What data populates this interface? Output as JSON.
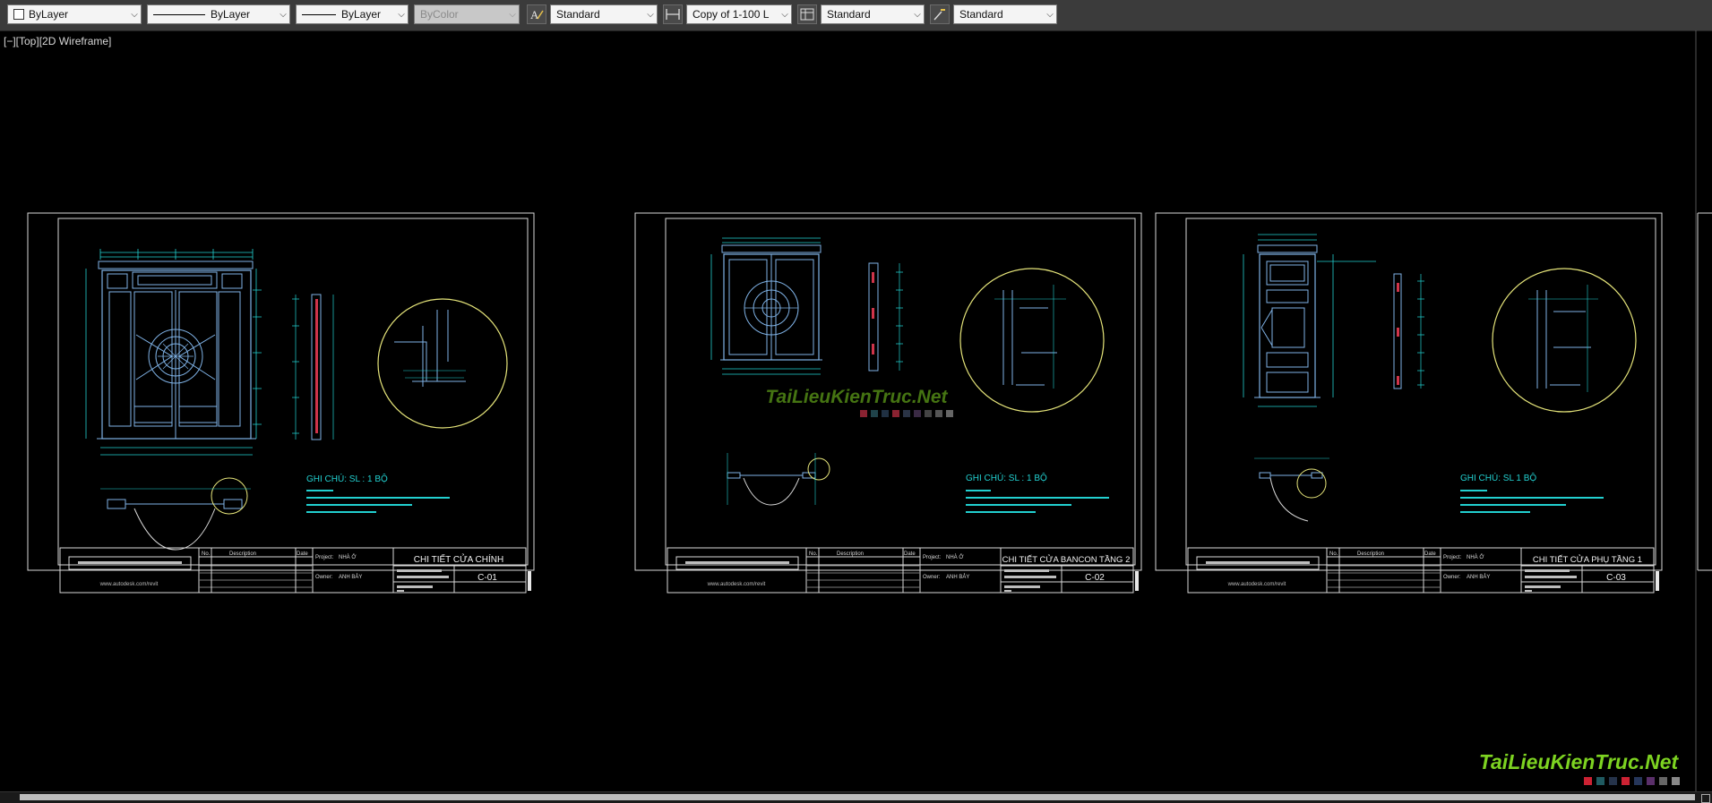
{
  "toolbar": {
    "color_select": "ByLayer",
    "linetype_select": "ByLayer",
    "lineweight_select": "ByLayer",
    "plotstyle_select": "ByColor",
    "textstyle_select": "Standard",
    "dimstyle_select": "Copy of 1-100 L",
    "tablestyle_select": "Standard",
    "mleaderstyle_select": "Standard"
  },
  "viewport": {
    "label": "[−][Top][2D Wireframe]"
  },
  "watermark": {
    "main": "TaiLieuKienTruc.Net",
    "center": "TaiLieuKienTruc.Net"
  },
  "sheets": [
    {
      "title": "CHI TIẾT CỬA CHÍNH",
      "number": "C-01",
      "note_heading": "GHI CHÚ: SL : 1 BỘ",
      "project_label": "Project:",
      "project": "NHÀ Ở",
      "owner_label": "Owner:",
      "owner": "ANH BẢY",
      "url": "www.autodesk.com/revit",
      "col_no": "No.",
      "col_desc": "Description",
      "col_date": "Date"
    },
    {
      "title": "CHI TIẾT CỬA BANCON TẦNG 2",
      "number": "C-02",
      "note_heading": "GHI CHÚ: SL : 1 BỘ",
      "project_label": "Project:",
      "project": "NHÀ Ở",
      "owner_label": "Owner:",
      "owner": "ANH BẢY",
      "url": "www.autodesk.com/revit",
      "col_no": "No.",
      "col_desc": "Description",
      "col_date": "Date"
    },
    {
      "title": "CHI TIẾT CỬA PHỤ TẦNG 1",
      "number": "C-03",
      "note_heading": "GHI CHÚ: SL 1 BỘ",
      "project_label": "Project:",
      "project": "NHÀ Ở",
      "owner_label": "Owner:",
      "owner": "ANH BẢY",
      "url": "www.autodesk.com/revit",
      "col_no": "No.",
      "col_desc": "Description",
      "col_date": "Date"
    }
  ],
  "colors": {
    "background": "#000000",
    "frame": "#d9d9d9",
    "door": "#7fb2e6",
    "dimension": "#22d0d0",
    "circle": "#e6e57a",
    "accent_red": "#d0344a",
    "note_text": "#22d0d0",
    "watermark_green": "#7dd321"
  }
}
